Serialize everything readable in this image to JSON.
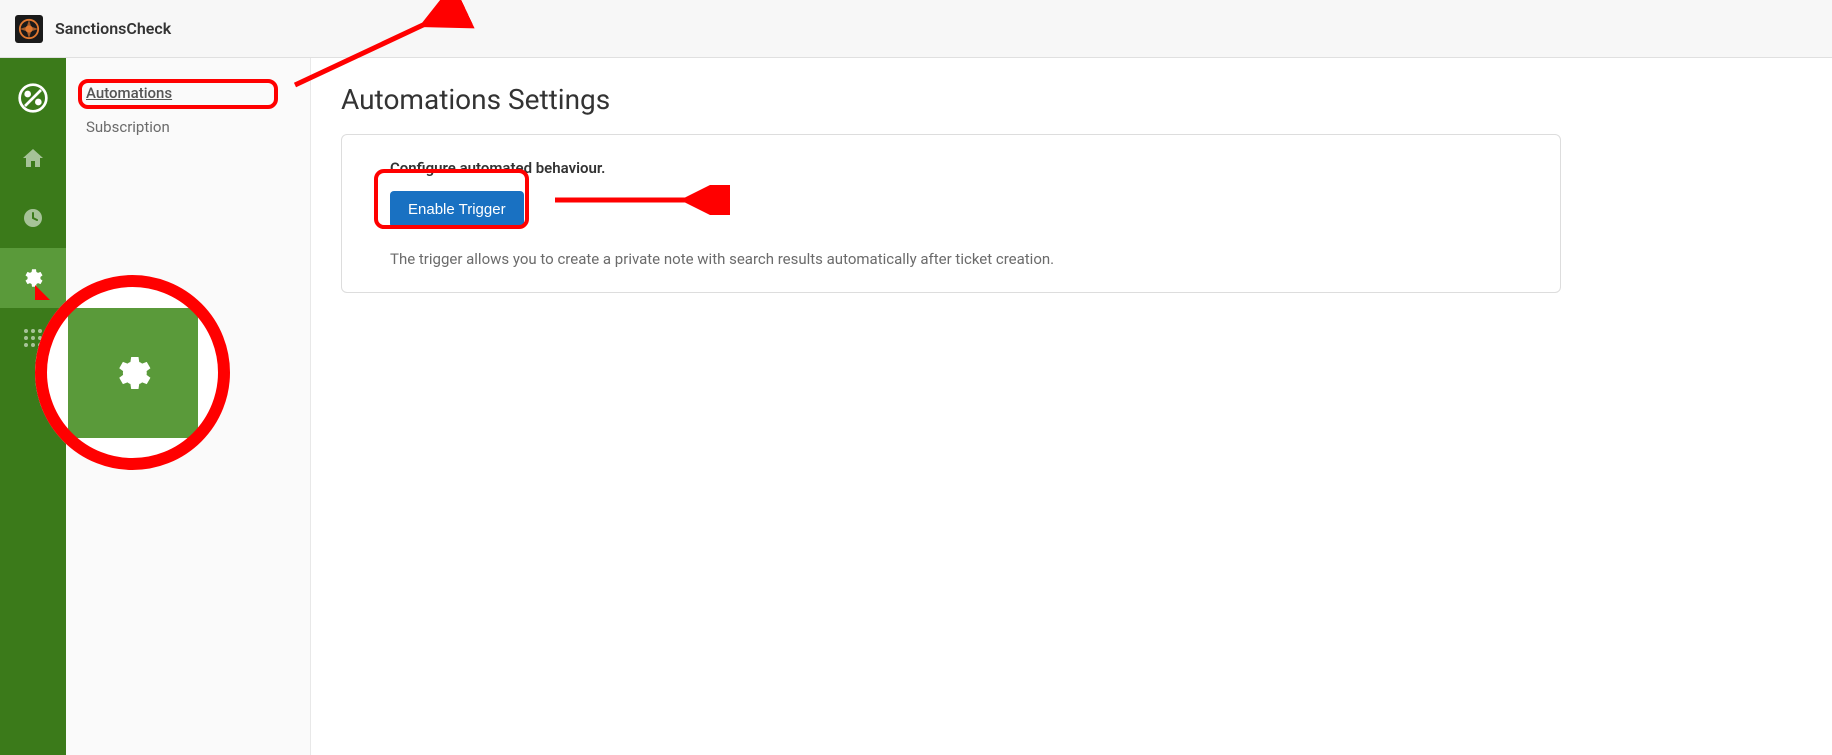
{
  "header": {
    "title": "SanctionsCheck"
  },
  "icon_sidebar": {
    "items": [
      {
        "name": "sanctions-icon"
      },
      {
        "name": "home-icon"
      },
      {
        "name": "clock-icon"
      },
      {
        "name": "settings-icon"
      },
      {
        "name": "apps-icon"
      }
    ]
  },
  "sub_sidebar": {
    "items": [
      {
        "label": "Automations",
        "active": true
      },
      {
        "label": "Subscription",
        "active": false
      }
    ]
  },
  "main": {
    "page_title": "Automations Settings",
    "panel_label": "Configure automated behaviour.",
    "button_label": "Enable Trigger",
    "description": "The trigger allows you to create a private note with search results automatically after ticket creation."
  }
}
